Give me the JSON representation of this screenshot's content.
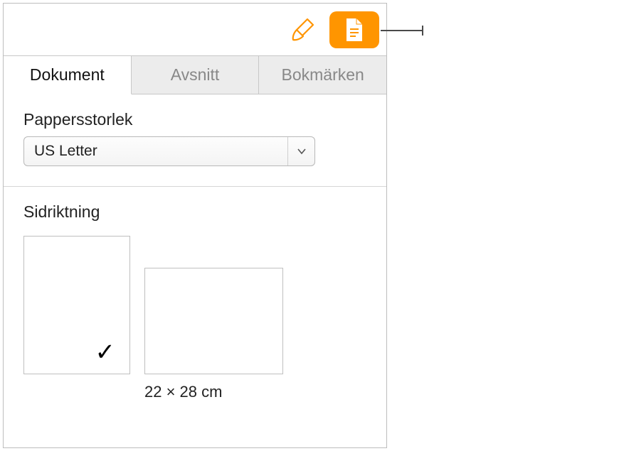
{
  "toolbar": {
    "format_icon": "paintbrush-icon",
    "document_icon": "document-icon"
  },
  "tabs": {
    "document": "Dokument",
    "section": "Avsnitt",
    "bookmarks": "Bokmärken"
  },
  "paper_size": {
    "label": "Pappersstorlek",
    "value": "US Letter"
  },
  "orientation": {
    "label": "Sidriktning",
    "dimensions": "22 × 28 cm",
    "selected": "portrait"
  }
}
